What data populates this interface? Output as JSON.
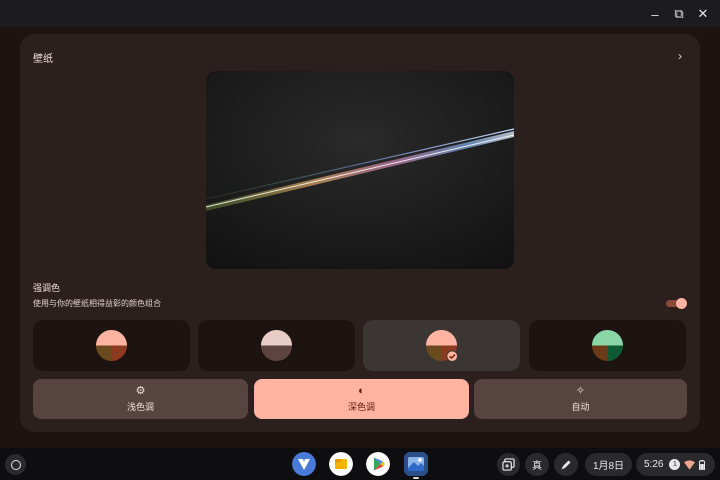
{
  "window": {
    "controls": {
      "minimize": "–",
      "maximize": "⧉",
      "close": "✕"
    }
  },
  "wallpaper_section": {
    "title": "壁纸",
    "chevron": "›"
  },
  "accent_section": {
    "title": "强调色",
    "subtitle": "使用与你的壁纸相得益彰的颜色组合",
    "toggle_on": true
  },
  "color_options": [
    {
      "name": "palette-1",
      "top": "#ffb4a1",
      "bottom_left": "#6b4a1f",
      "bottom_right": "#8c3a20",
      "selected": false
    },
    {
      "name": "palette-2",
      "top": "#e7cdc6",
      "bottom_left": "#5e4440",
      "bottom_right": "#5e4440",
      "selected": false
    },
    {
      "name": "palette-3",
      "top": "#ffb4a1",
      "bottom_left": "#6b4a1f",
      "bottom_right": "#8c3a20",
      "selected": true
    },
    {
      "name": "palette-4",
      "top": "#8ad6a6",
      "bottom_left": "#6b3a16",
      "bottom_right": "#0f5b35",
      "selected": false
    }
  ],
  "modes": {
    "light": {
      "label": "浅色调",
      "icon": "brightness-icon"
    },
    "dark": {
      "label": "深色调",
      "icon": "contrast-icon"
    },
    "auto": {
      "label": "自动",
      "icon": "magic-wand-icon"
    }
  },
  "shelf": {
    "ime_label": "真",
    "date": "1月8日",
    "time": "5:26",
    "notification_count": "1"
  },
  "colors": {
    "accent": "#ffb4a1",
    "card_bg": "#2b201d",
    "window_bg": "#1d1311"
  }
}
